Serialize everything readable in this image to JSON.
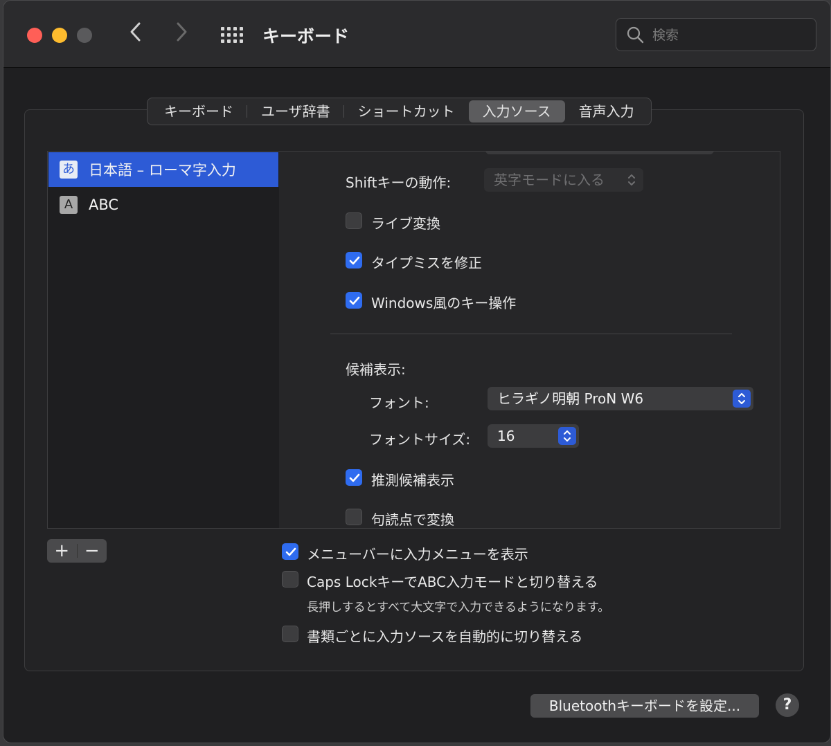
{
  "window": {
    "title": "キーボード",
    "search_placeholder": "検索"
  },
  "tabs": [
    {
      "label": "キーボード",
      "active": false
    },
    {
      "label": "ユーザ辞書",
      "active": false
    },
    {
      "label": "ショートカット",
      "active": false
    },
    {
      "label": "入力ソース",
      "active": true
    },
    {
      "label": "音声入力",
      "active": false
    }
  ],
  "input_sources": [
    {
      "icon_char": "あ",
      "label": "日本語 – ローマ字入力",
      "selected": true
    },
    {
      "icon_char": "A",
      "label": "ABC",
      "selected": false
    }
  ],
  "detail": {
    "shift_label": "Shiftキーの動作:",
    "shift_value": "英字モードに入る",
    "live_conversion": {
      "label": "ライブ変換",
      "checked": false
    },
    "typo_correction": {
      "label": "タイプミスを修正",
      "checked": true
    },
    "windows_keys": {
      "label": "Windows風のキー操作",
      "checked": true
    },
    "candidates_heading": "候補表示:",
    "font_label": "フォント:",
    "font_value": "ヒラギノ明朝 ProN W6",
    "font_size_label": "フォントサイズ:",
    "font_size_value": "16",
    "predictive": {
      "label": "推測候補表示",
      "checked": true
    },
    "punctuation_convert": {
      "label": "句読点で変換",
      "checked": false
    }
  },
  "list_buttons": {
    "add": "+",
    "remove": "−"
  },
  "options": {
    "show_input_menu": {
      "label": "メニューバーに入力メニューを表示",
      "checked": true
    },
    "caps_lock_abc": {
      "label": "Caps LockキーでABC入力モードと切り替える",
      "checked": false
    },
    "caps_lock_note": "長押しするとすべて大文字で入力できるようになります。",
    "auto_switch": {
      "label": "書類ごとに入力ソースを自動的に切り替える",
      "checked": false
    }
  },
  "footer": {
    "bluetooth_button": "Bluetoothキーボードを設定...",
    "help_button": "?"
  },
  "colors": {
    "accent": "#2f6cf0",
    "selection": "#2d5bd6",
    "close": "#ff5f57",
    "minimize": "#febc2e"
  }
}
